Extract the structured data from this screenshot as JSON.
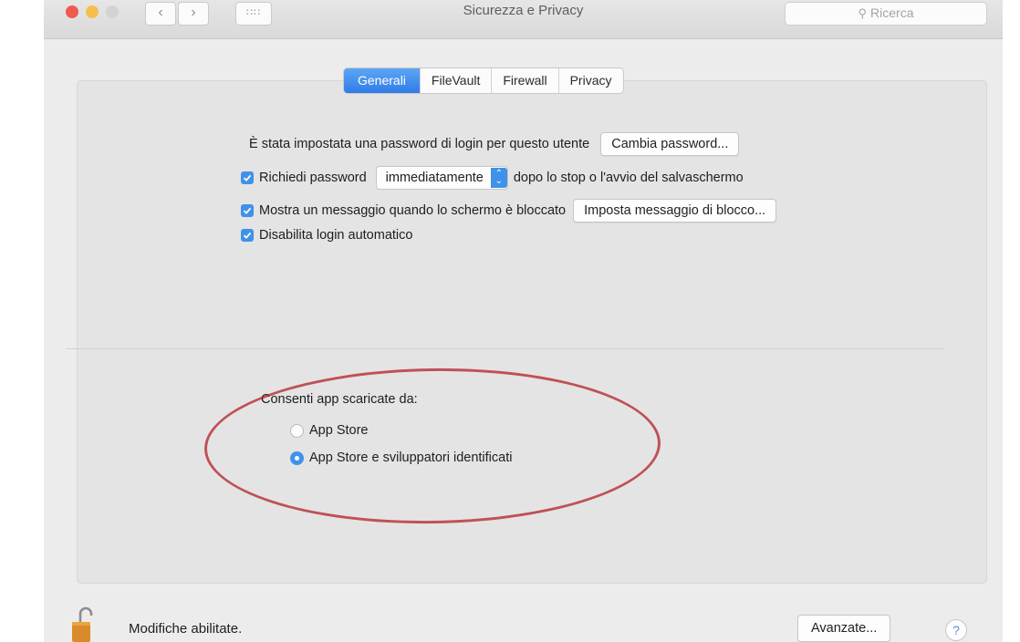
{
  "window": {
    "title": "Sicurezza e Privacy",
    "nav_back": "‹",
    "nav_forward": "›",
    "nav_grid": "∷∷",
    "search_placeholder": "Ricerca"
  },
  "tabs": [
    {
      "label": "Generali",
      "active": true
    },
    {
      "label": "FileVault",
      "active": false
    },
    {
      "label": "Firewall",
      "active": false
    },
    {
      "label": "Privacy",
      "active": false
    }
  ],
  "general": {
    "login_password_text": "È stata impostata una password di login per questo utente",
    "change_password_button": "Cambia password...",
    "require_password_label": "Richiedi password",
    "require_password_value": "immediatamente",
    "require_password_suffix": "dopo lo stop o l'avvio del salvaschermo",
    "show_message_label": "Mostra un messaggio quando lo schermo è bloccato",
    "set_lock_message_button": "Imposta messaggio di blocco...",
    "disable_autologin_label": "Disabilita login automatico"
  },
  "downloads": {
    "heading": "Consenti app scaricate da:",
    "options": [
      {
        "label": "App Store",
        "selected": false
      },
      {
        "label": "App Store e sviluppatori identificati",
        "selected": true
      }
    ]
  },
  "footer": {
    "lock_status": "Modifiche abilitate.",
    "advanced_button": "Avanzate...",
    "help_button": "?"
  },
  "colors": {
    "accent": "#3f92ea",
    "annotation": "#b01820"
  }
}
